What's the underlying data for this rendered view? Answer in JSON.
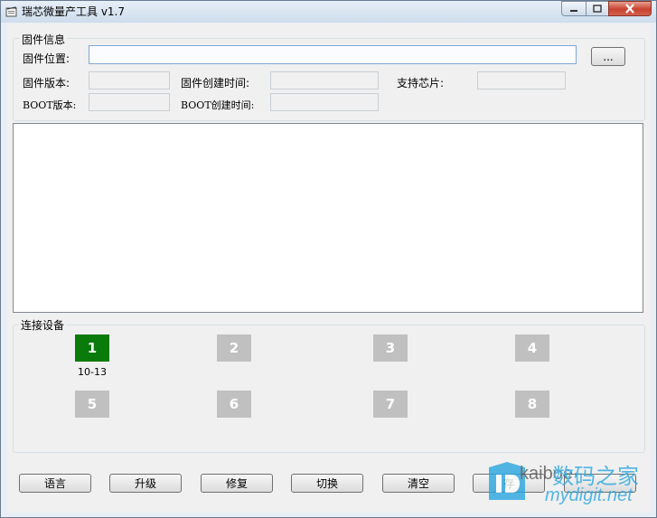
{
  "window": {
    "title": "瑞芯微量产工具 v1.7"
  },
  "firmware": {
    "group_title": "固件信息",
    "location_label": "固件位置:",
    "location_value": "",
    "browse_label": "...",
    "version_label": "固件版本:",
    "version_value": "",
    "create_time_label": "固件创建时间:",
    "create_time_value": "",
    "chip_label": "支持芯片:",
    "chip_value": "",
    "boot_version_label": "BOOT版本:",
    "boot_version_value": "",
    "boot_create_time_label": "BOOT创建时间:",
    "boot_create_time_value": ""
  },
  "devices": {
    "group_title": "连接设备",
    "slots": [
      {
        "label": "1",
        "sub": "10-13",
        "active": true
      },
      {
        "label": "2",
        "sub": "",
        "active": false
      },
      {
        "label": "3",
        "sub": "",
        "active": false
      },
      {
        "label": "4",
        "sub": "",
        "active": false
      },
      {
        "label": "5",
        "sub": "",
        "active": false
      },
      {
        "label": "6",
        "sub": "",
        "active": false
      },
      {
        "label": "7",
        "sub": "",
        "active": false
      },
      {
        "label": "8",
        "sub": "",
        "active": false
      }
    ],
    "active_color": "#0a7a0a",
    "inactive_color": "#c0c0c0"
  },
  "buttons": {
    "language": "语言",
    "upgrade": "升级",
    "repair": "修复",
    "switch": "切换",
    "clear": "清空",
    "partial": "存"
  },
  "watermark": {
    "brand_cn": "数码之家",
    "brand_en": "kaiboe·",
    "site": "mydigit.net"
  }
}
